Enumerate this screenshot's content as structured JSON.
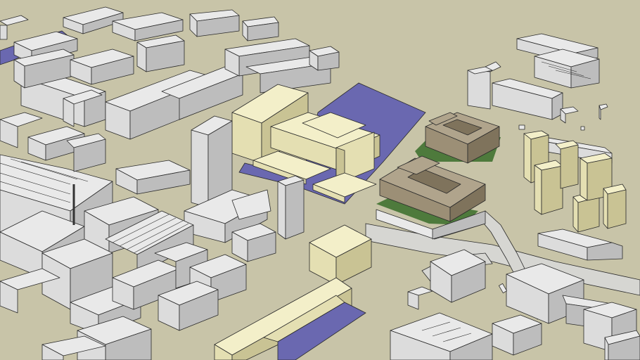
{
  "viewer": {
    "app": "3D model viewer",
    "ground_color": "#c8c4a8",
    "water_color": "#6a68b0",
    "highlight_building_color": "#f3efc9",
    "proposed_building_color": "#b0a48c",
    "context_building_color": "#e9e9e9",
    "green_roof_color": "#4e7a3c"
  },
  "scene": {
    "objects": [
      {
        "name": "canal-basin",
        "kind": "water"
      },
      {
        "name": "river-channel",
        "kind": "water"
      },
      {
        "name": "concert-hall",
        "kind": "highlighted-building"
      },
      {
        "name": "office-tower",
        "kind": "context-building"
      },
      {
        "name": "courtyard-block-north",
        "kind": "proposed-building"
      },
      {
        "name": "courtyard-block-south",
        "kind": "proposed-building"
      },
      {
        "name": "residential-towers-east",
        "kind": "highlighted-building"
      },
      {
        "name": "long-slab-foreground",
        "kind": "highlighted-building"
      },
      {
        "name": "railway-station-shed",
        "kind": "context-building"
      },
      {
        "name": "tram-junction",
        "kind": "road"
      }
    ]
  }
}
